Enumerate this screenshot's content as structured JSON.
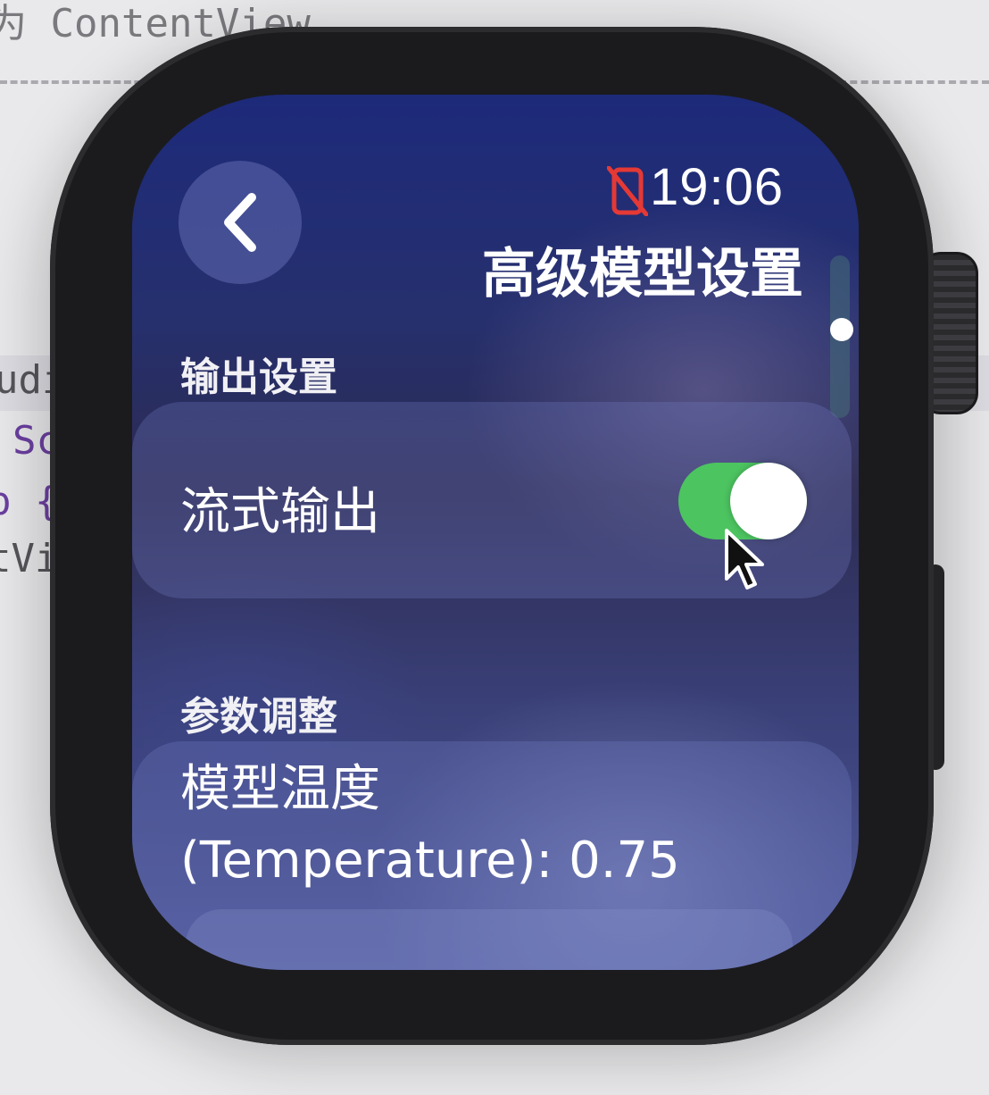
{
  "editor": {
    "top_line": "为 ContentView",
    "fragment_1": "udi",
    "fragment_2": "Sc",
    "fragment_3": "p {",
    "fragment_4": "tVi"
  },
  "status": {
    "time": "19:06",
    "phone_disconnected_icon": "phone-slash-icon",
    "icon_color": "#e53935"
  },
  "nav": {
    "back_icon": "chevron-left-icon",
    "title": "高级模型设置"
  },
  "sections": {
    "output": {
      "header": "输出设置",
      "stream_label": "流式输出",
      "stream_enabled": true
    },
    "params": {
      "header": "参数调整",
      "temperature_label_line1": "模型温度",
      "temperature_label_line2": "(Temperature): 0.75"
    }
  },
  "colors": {
    "toggle_on": "#4cc460",
    "accent_text": "#ffffff"
  }
}
